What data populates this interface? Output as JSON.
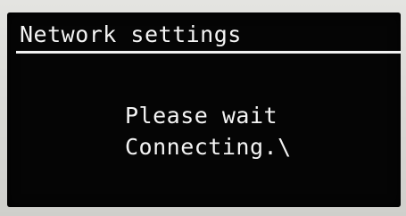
{
  "screen": {
    "title": "Network settings",
    "message_line1": "Please wait",
    "message_line2": "Connecting.\\"
  }
}
